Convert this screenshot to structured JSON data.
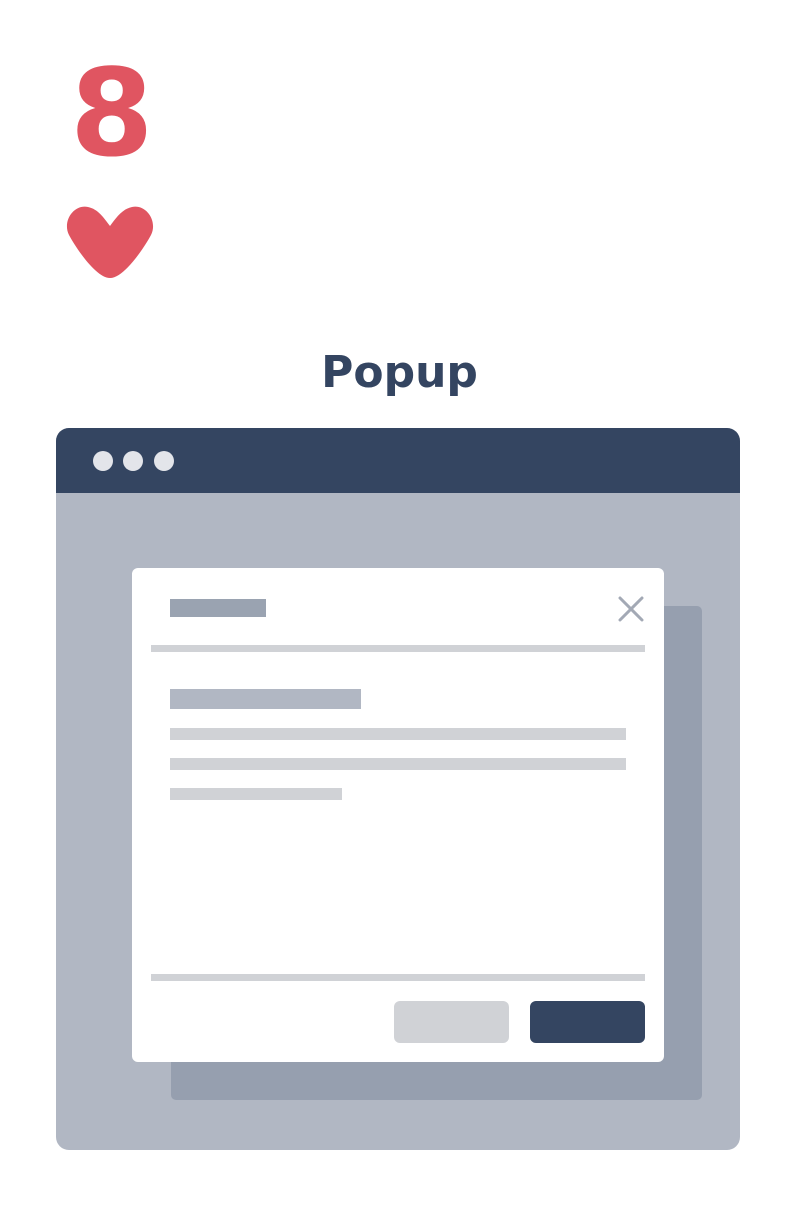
{
  "card": {
    "rank": "8",
    "suit_icon": "heart-icon",
    "title": "Popup",
    "accent_color": "#E05561",
    "title_color": "#344561"
  },
  "browser_window": {
    "titlebar_color": "#344561",
    "background_color": "#B1B7C3",
    "window_controls": [
      "dot",
      "dot",
      "dot"
    ]
  },
  "popup": {
    "close_icon": "close-icon",
    "secondary_button_color": "#D0D2D6",
    "primary_button_color": "#344561"
  }
}
